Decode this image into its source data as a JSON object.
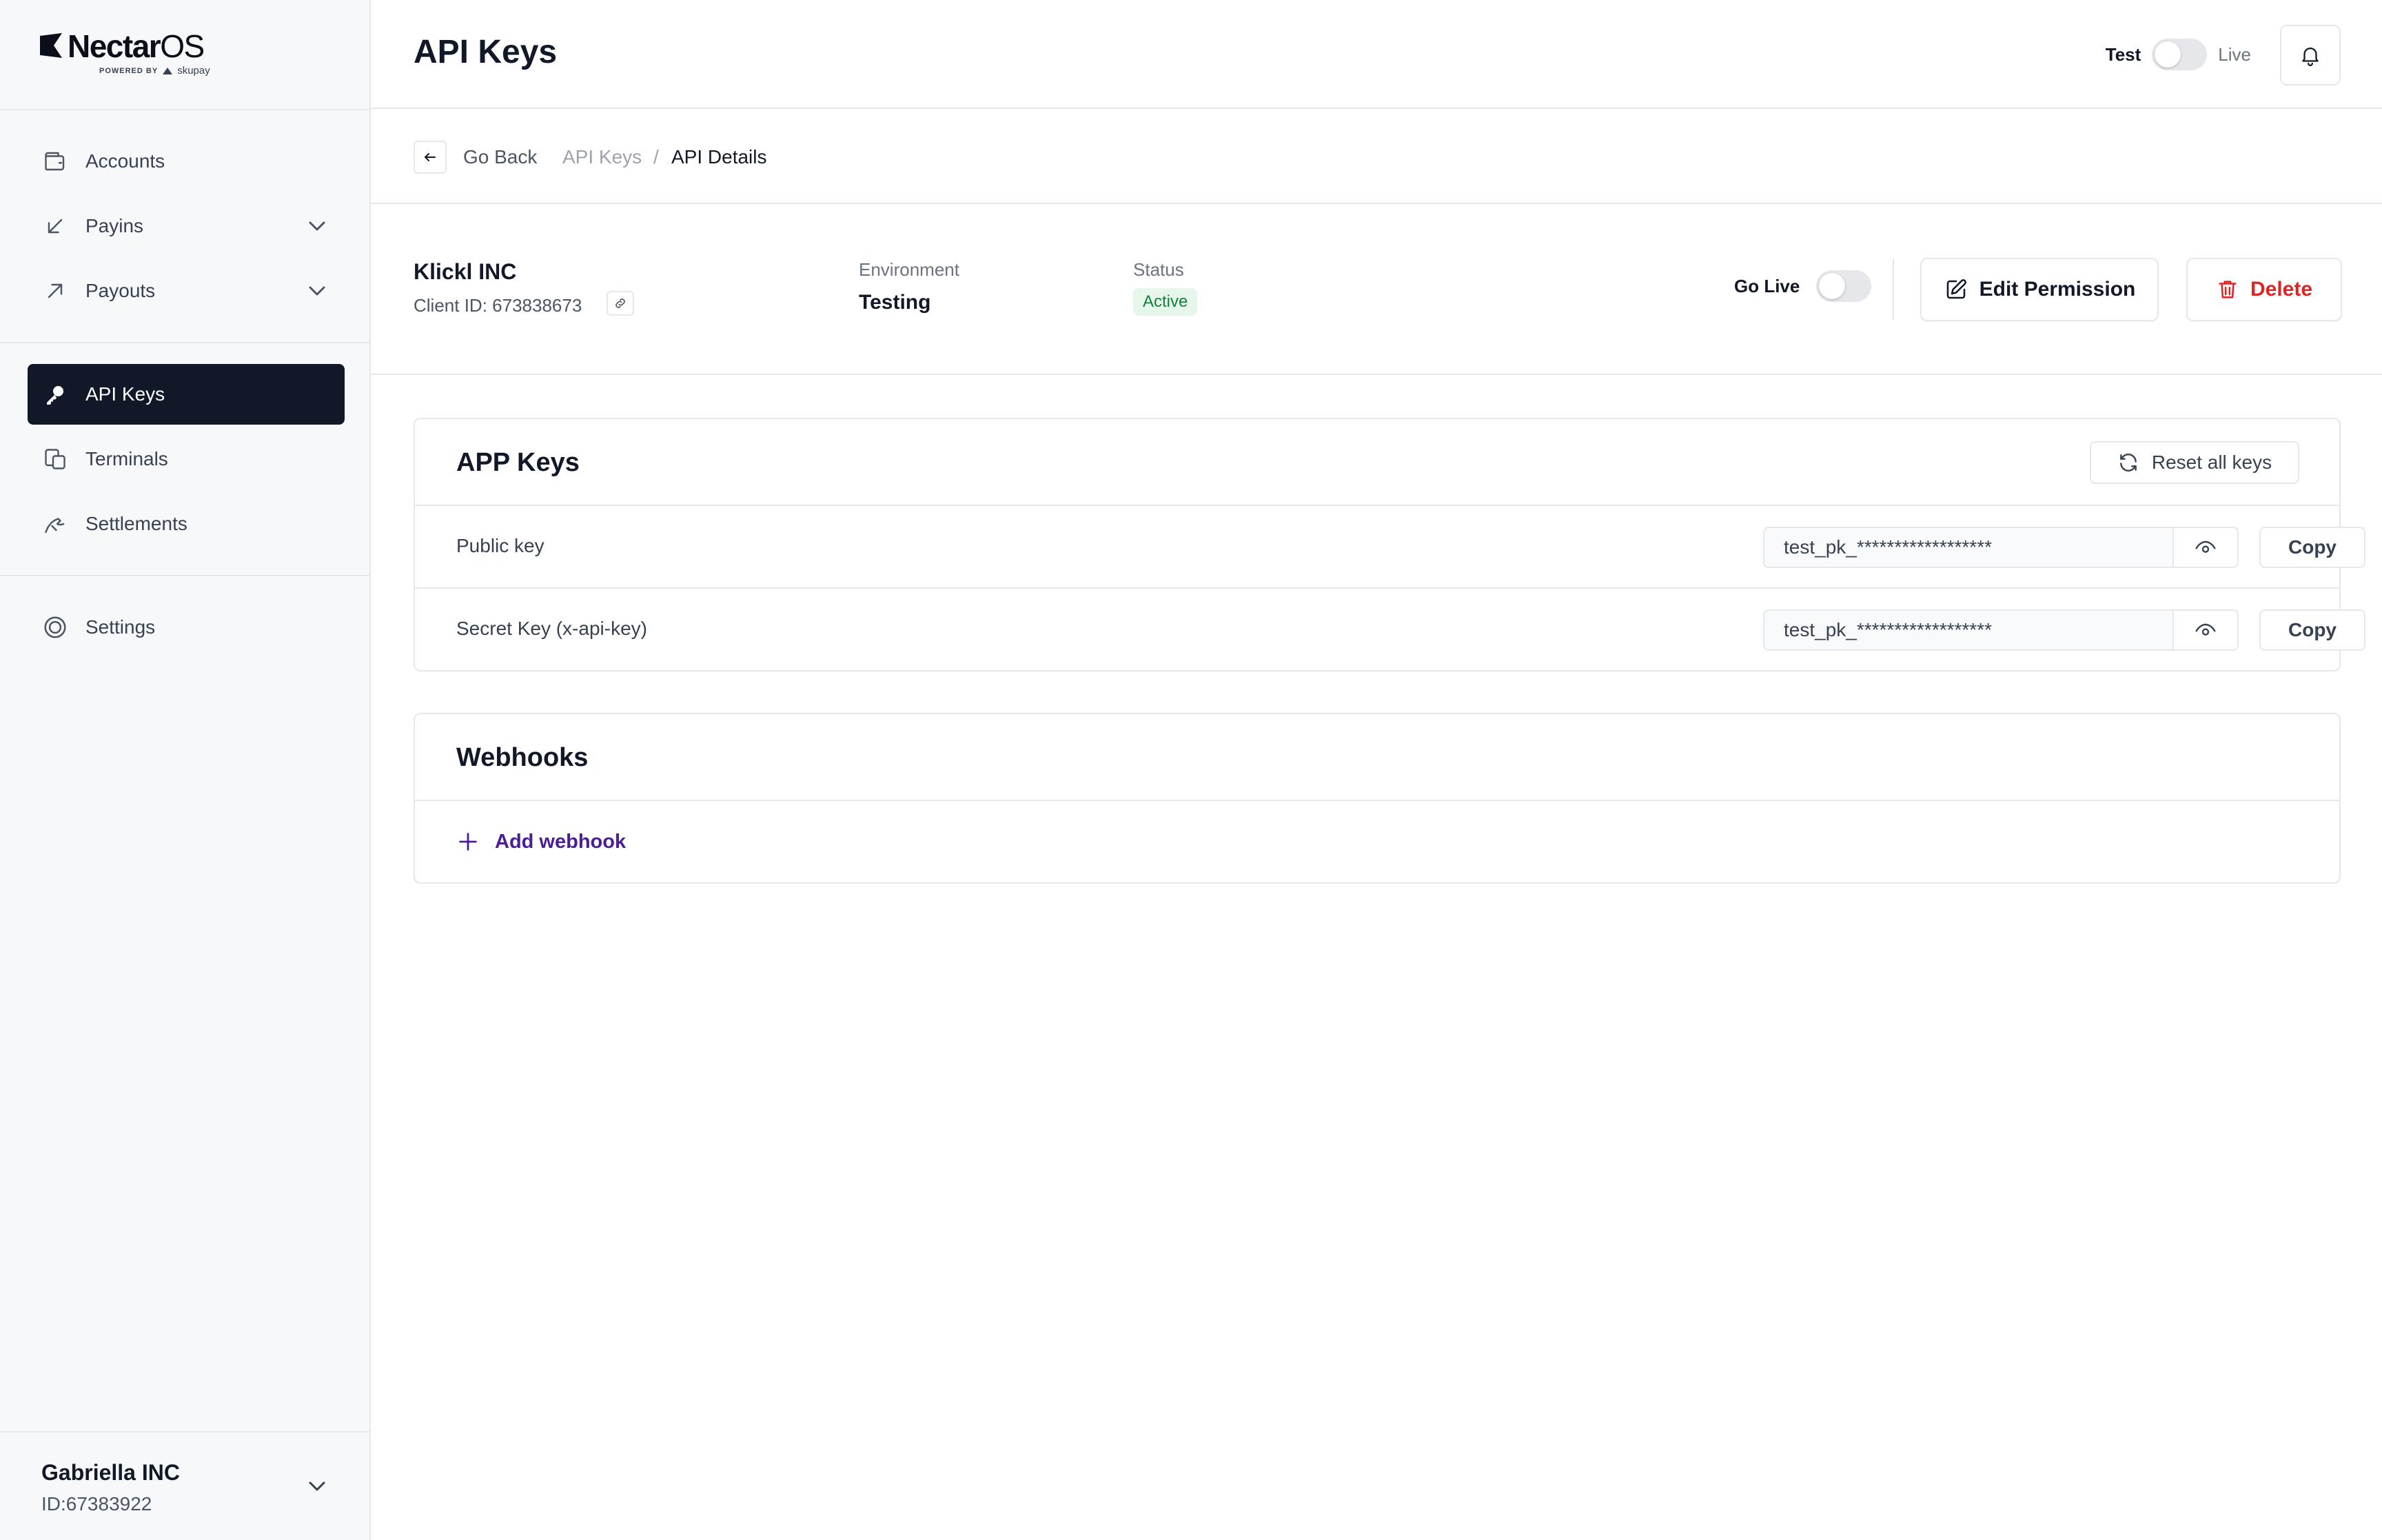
{
  "brand": {
    "name_bold": "Nectar",
    "name_light": "OS",
    "powered_by": "POWERED BY",
    "powered_brand": "skupay"
  },
  "sidebar": {
    "items": [
      {
        "label": "Accounts",
        "icon": "wallet-icon"
      },
      {
        "label": "Payins",
        "icon": "arrow-down-left-icon",
        "has_submenu": true
      },
      {
        "label": "Payouts",
        "icon": "arrow-up-right-icon",
        "has_submenu": true
      },
      {
        "label": "API Keys",
        "icon": "key-icon",
        "active": true
      },
      {
        "label": "Terminals",
        "icon": "devices-icon"
      },
      {
        "label": "Settlements",
        "icon": "handshake-icon"
      },
      {
        "label": "Settings",
        "icon": "gear-icon"
      }
    ],
    "account": {
      "name": "Gabriella INC",
      "id": "ID:67383922"
    }
  },
  "header": {
    "title": "API Keys",
    "env_test": "Test",
    "env_live": "Live",
    "live_mode": false
  },
  "breadcrumb": {
    "go_back": "Go Back",
    "parent": "API Keys",
    "separator": "/",
    "current": "API Details"
  },
  "detail": {
    "client_name": "Klickl INC",
    "client_id": "Client ID: 673838673",
    "environment_label": "Environment",
    "environment_value": "Testing",
    "status_label": "Status",
    "status_value": "Active",
    "go_live_label": "Go Live",
    "go_live_on": false,
    "edit_button": "Edit Permission",
    "delete_button": "Delete"
  },
  "app_keys": {
    "title": "APP Keys",
    "reset_button": "Reset all keys",
    "rows": [
      {
        "label": "Public key",
        "value": "test_pk_******************",
        "copy": "Copy"
      },
      {
        "label": "Secret Key (x-api-key)",
        "value": "test_pk_******************",
        "copy": "Copy"
      }
    ]
  },
  "webhooks": {
    "title": "Webhooks",
    "add_button": "Add webhook"
  },
  "colors": {
    "active_nav_bg": "#111827",
    "delete_red": "#dc2626",
    "status_green": "#15803d",
    "status_green_bg": "#e7f6ea",
    "webhook_purple": "#4c1d95"
  }
}
